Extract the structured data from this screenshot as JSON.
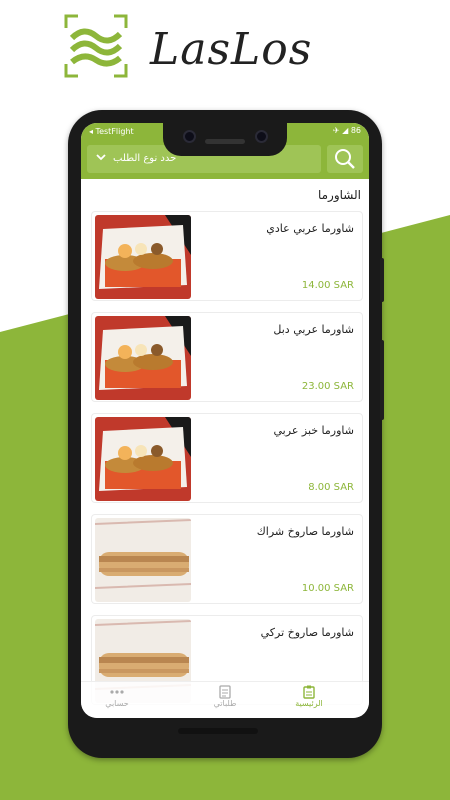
{
  "brand": {
    "name": "LasLos"
  },
  "colors": {
    "accent": "#8db63a",
    "background_green": "#8db63a"
  },
  "status_bar": {
    "back_label": "◂ TestFlight",
    "icons": "✈ ◢ 86"
  },
  "header": {
    "order_type_placeholder": "حدد نوع الطلب",
    "chevron_icon": "chevron-down-icon",
    "search_icon": "search-icon"
  },
  "section": {
    "title": "الشاورما"
  },
  "items": [
    {
      "name": "شاورما عربي عادي",
      "price": "14.00 SAR",
      "image": "shawarma-box"
    },
    {
      "name": "شاورما عربي دبل",
      "price": "23.00 SAR",
      "image": "shawarma-box"
    },
    {
      "name": "شاورما خبز عربي",
      "price": "8.00 SAR",
      "image": "shawarma-box"
    },
    {
      "name": "شاورما صاروخ شراك",
      "price": "10.00 SAR",
      "image": "shawarma-roll"
    },
    {
      "name": "شاورما صاروخ تركي",
      "price": "",
      "image": "shawarma-roll"
    }
  ],
  "tabs": [
    {
      "label": "الرئيسية",
      "icon": "clipboard-icon",
      "active": true
    },
    {
      "label": "طلباتي",
      "icon": "document-icon",
      "active": false
    },
    {
      "label": "حسابي",
      "icon": "more-dots-icon",
      "active": false
    }
  ]
}
